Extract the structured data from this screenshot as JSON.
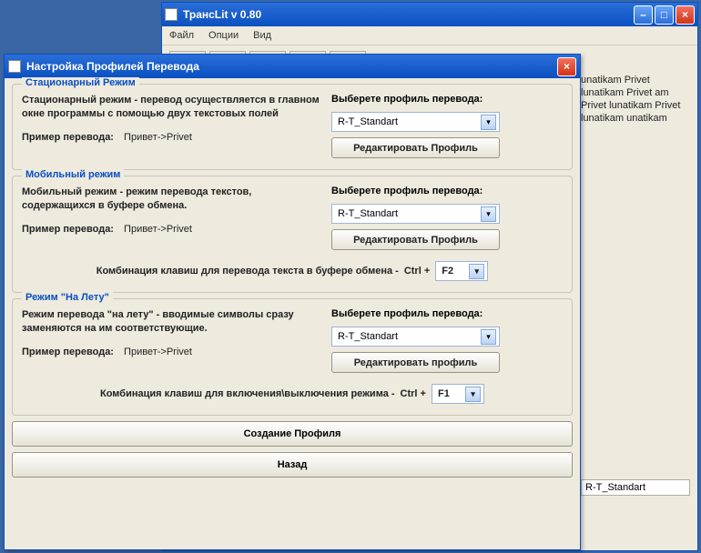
{
  "main": {
    "title": "ТрансLit v 0.80",
    "menu": {
      "file": "Файл",
      "options": "Опции",
      "view": "Вид"
    },
    "side_text": "unatikam Privet lunatikam Privet am Privet lunatikam Privet lunatikam unatikam",
    "status": "R-T_Standart"
  },
  "dlg": {
    "title": "Настройка Профилей Перевода",
    "stationary": {
      "group_title": "Стационарный Режим",
      "desc": "Стационарный режим - перевод осуществляется в главном окне программы с помощью двух текстовых полей",
      "example_label": "Пример перевода:",
      "example_value": "Привет->Privet",
      "select_label": "Выберете профиль перевода:",
      "select_value": "R-T_Standart",
      "edit_btn": "Редактировать Профиль"
    },
    "mobile": {
      "group_title": "Мобильный режим",
      "desc": "Мобильный режим - режим перевода текстов, содержащихся в буфере обмена.",
      "example_label": "Пример перевода:",
      "example_value": "Привет->Privet",
      "select_label": "Выберете профиль перевода:",
      "select_value": "R-T_Standart",
      "edit_btn": "Редактировать Профиль",
      "hotkey_label": "Комбинация клавиш для перевода текста в буфере обмена -",
      "hotkey_prefix": "Ctrl +",
      "hotkey_value": "F2"
    },
    "onfly": {
      "group_title": "Режим \"На Лету\"",
      "desc": "Режим перевода \"на лету\" - вводимые символы сразу заменяются на им соответствующие.",
      "example_label": "Пример перевода:",
      "example_value": "Привет->Privet",
      "select_label": "Выберете профиль перевода:",
      "select_value": "R-T_Standart",
      "edit_btn": "Редактировать профиль",
      "hotkey_label": "Комбинация клавиш для включения\\выключения режима -",
      "hotkey_prefix": "Ctrl +",
      "hotkey_value": "F1"
    },
    "create_btn": "Создание Профиля",
    "back_btn": "Назад"
  }
}
